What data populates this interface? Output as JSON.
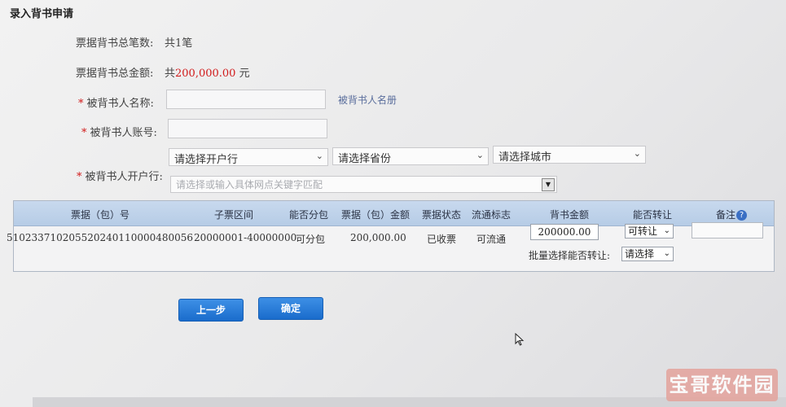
{
  "page": {
    "title": "录入背书申请"
  },
  "summary": {
    "count_label": "票据背书总笔数:",
    "count_value": "共1笔",
    "amount_label": "票据背书总金额:",
    "amount_prefix": "共",
    "amount_value": "200,000.00",
    "amount_unit": "元"
  },
  "form": {
    "required_mark": "*",
    "endorsee_name_label": "被背书人名称:",
    "endorsee_name_value": "",
    "endorsee_directory_link": "被背书人名册",
    "endorsee_account_label": "被背书人账号:",
    "endorsee_account_value": "",
    "endorsee_bank_label": "被背书人开户行:",
    "bank_select": "请选择开户行",
    "province_select": "请选择省份",
    "city_select": "请选择城市",
    "branch_combo_placeholder": "请选择或输入具体网点关键字匹配"
  },
  "table": {
    "headers": [
      "票据（包）号",
      "子票区间",
      "能否分包",
      "票据（包）金额",
      "票据状态",
      "流通标志",
      "背书金额",
      "能否转让",
      "备注"
    ],
    "rows": [
      {
        "bill_no": "510233710205520240110000480056",
        "sub_range": "20000001-40000000",
        "splittable": "可分包",
        "amount": "200,000.00",
        "status": "已收票",
        "circulation": "可流通",
        "endorse_amount": "200000.00",
        "transferable": "可转让",
        "remark": ""
      }
    ],
    "batch_label": "批量选择能否转让:",
    "batch_select": "请选择"
  },
  "actions": {
    "prev_label": "上一步",
    "confirm_label": "确定"
  },
  "icons": {
    "dropdown": "chevron-down-icon",
    "help": "question-circle-icon",
    "cursor": "mouse-pointer-icon"
  },
  "colors": {
    "accent": "#1a6ccc",
    "header_bg": "#c8d9ee",
    "required": "#d11a1a"
  },
  "watermark": {
    "text": "宝哥软件园"
  }
}
